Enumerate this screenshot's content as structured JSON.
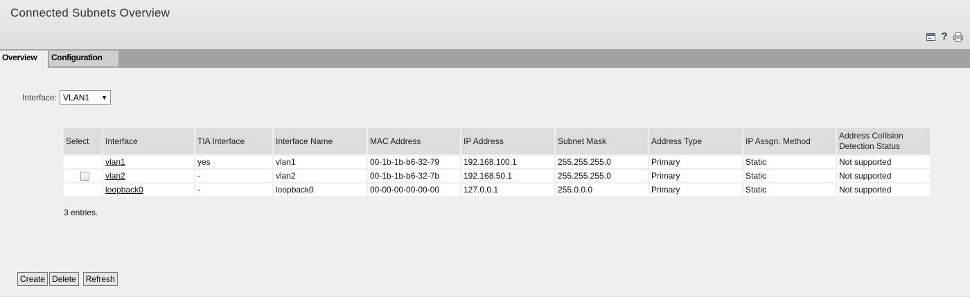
{
  "page": {
    "title": "Connected Subnets Overview"
  },
  "header_icons": [
    "window-icon",
    "help-icon",
    "print-icon"
  ],
  "tabs": [
    {
      "label": "Overview",
      "active": true
    },
    {
      "label": "Configuration",
      "active": false
    }
  ],
  "filter": {
    "label": "Interface:",
    "value": "VLAN1"
  },
  "table": {
    "headers": {
      "select": "Select",
      "interface": "Interface",
      "tia": "TIA Interface",
      "name": "Interface Name",
      "mac": "MAC Address",
      "ip": "IP Address",
      "mask": "Subnet Mask",
      "addr_type": "Address Type",
      "method": "IP Assgn. Method",
      "collision": "Address Collision Detection Status"
    },
    "rows": [
      {
        "interface": "vlan1",
        "tia": "yes",
        "name": "vlan1",
        "mac": "00-1b-1b-b6-32-79",
        "ip": "192.168.100.1",
        "mask": "255.255.255.0",
        "addr_type": "Primary",
        "method": "Static",
        "collision": "Not supported"
      },
      {
        "interface": "vlan2",
        "tia": "-",
        "name": "vlan2",
        "mac": "00-1b-1b-b6-32-7b",
        "ip": "192.168.50.1",
        "mask": "255.255.255.0",
        "addr_type": "Primary",
        "method": "Static",
        "collision": "Not supported"
      },
      {
        "interface": "loopback0",
        "tia": "-",
        "name": "loopback0",
        "mac": "00-00-00-00-00-00",
        "ip": "127.0.0.1",
        "mask": "255.0.0.0",
        "addr_type": "Primary",
        "method": "Static",
        "collision": "Not supported"
      }
    ]
  },
  "entries_text": "3 entries.",
  "buttons": {
    "create": "Create",
    "delete": "Delete",
    "refresh": "Refresh"
  }
}
